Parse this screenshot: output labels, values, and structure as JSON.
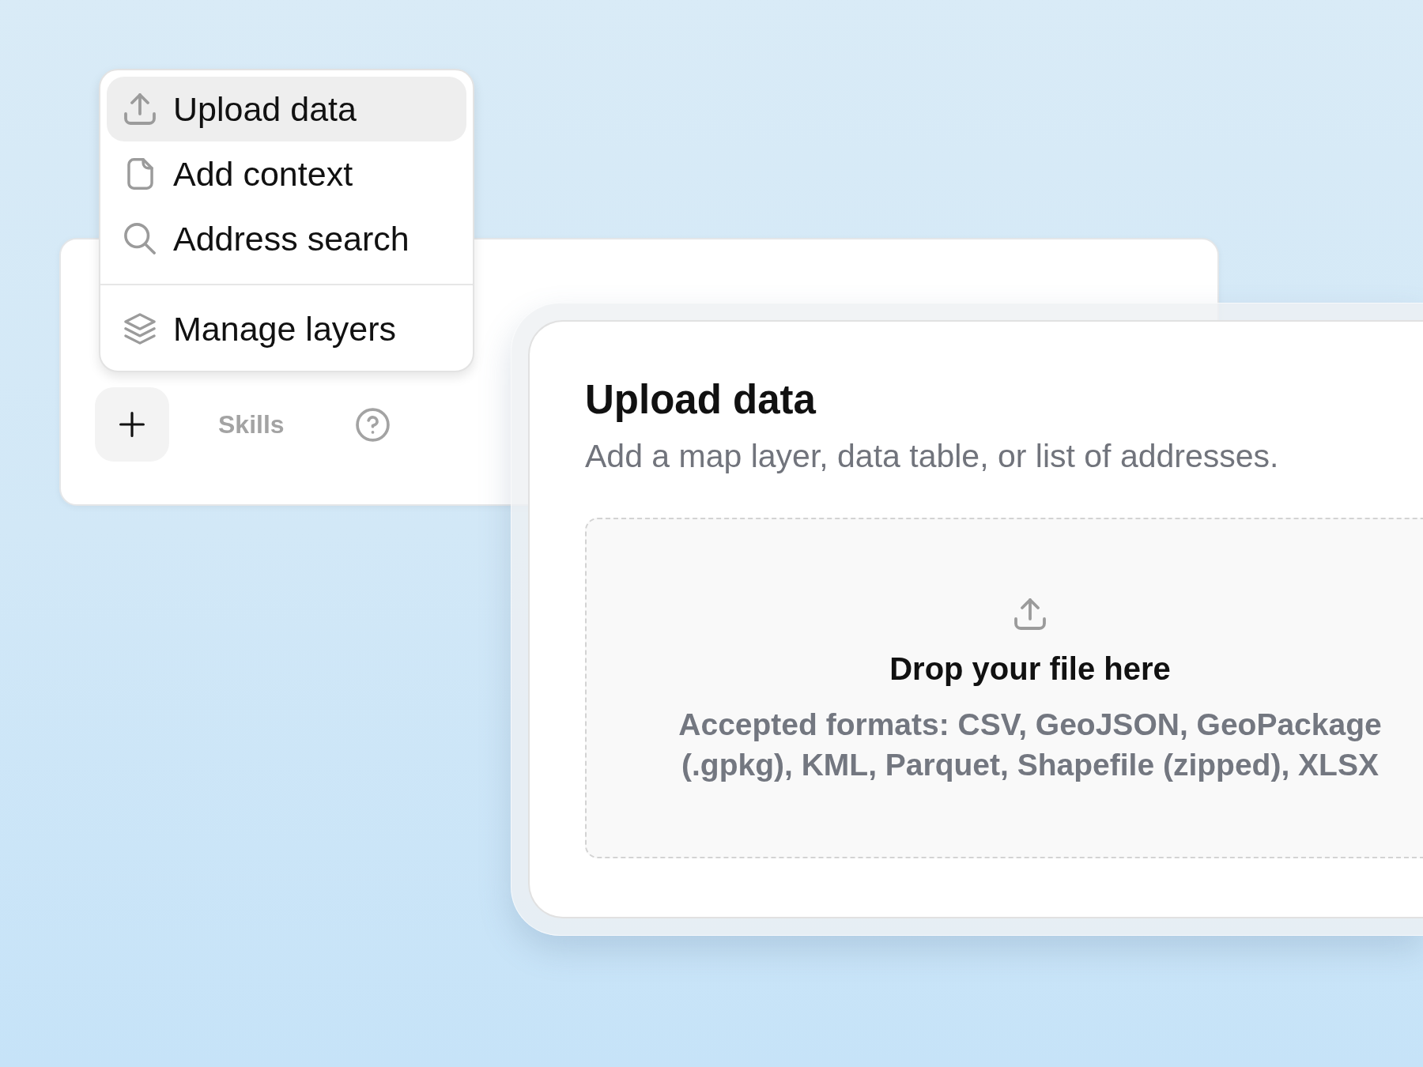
{
  "menu": {
    "groups": [
      {
        "items": [
          {
            "label": "Upload data",
            "selected": true
          },
          {
            "label": "Add context",
            "selected": false
          },
          {
            "label": "Address search",
            "selected": false
          }
        ]
      },
      {
        "items": [
          {
            "label": "Manage layers",
            "selected": false
          }
        ]
      }
    ]
  },
  "composer": {
    "skills_label": "Skills"
  },
  "dialog": {
    "title": "Upload data",
    "description": "Add a map layer, data table, or list of addresses.",
    "dropzone": {
      "heading": "Drop your file here",
      "formats": "Accepted formats: CSV, GeoJSON, GeoPackage (.gpkg), KML, Parquet, Shapefile (zipped), XLSX"
    }
  }
}
